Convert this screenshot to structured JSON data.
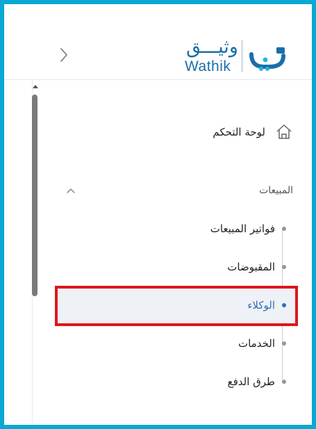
{
  "colors": {
    "frame": "#0aa8d4",
    "accent": "#2f6fb8",
    "highlight_border": "#e0161b",
    "brand": "#1a6fa8"
  },
  "header": {
    "expand_icon": "chevron-right-icon",
    "logo_arabic": "وثيـــق",
    "logo_english": "Wathik"
  },
  "nav": {
    "dashboard": {
      "label": "لوحة التحكم",
      "icon": "home-icon"
    },
    "sales_section": {
      "label": "المبيعات",
      "icon": "chevron-up-icon",
      "expanded": true
    },
    "sales_items": [
      {
        "label": "فواتير المبيعات"
      },
      {
        "label": "المقبوضات"
      },
      {
        "label": "الوكلاء",
        "active": true
      },
      {
        "label": "الخدمات"
      },
      {
        "label": "طرق الدفع"
      }
    ]
  }
}
